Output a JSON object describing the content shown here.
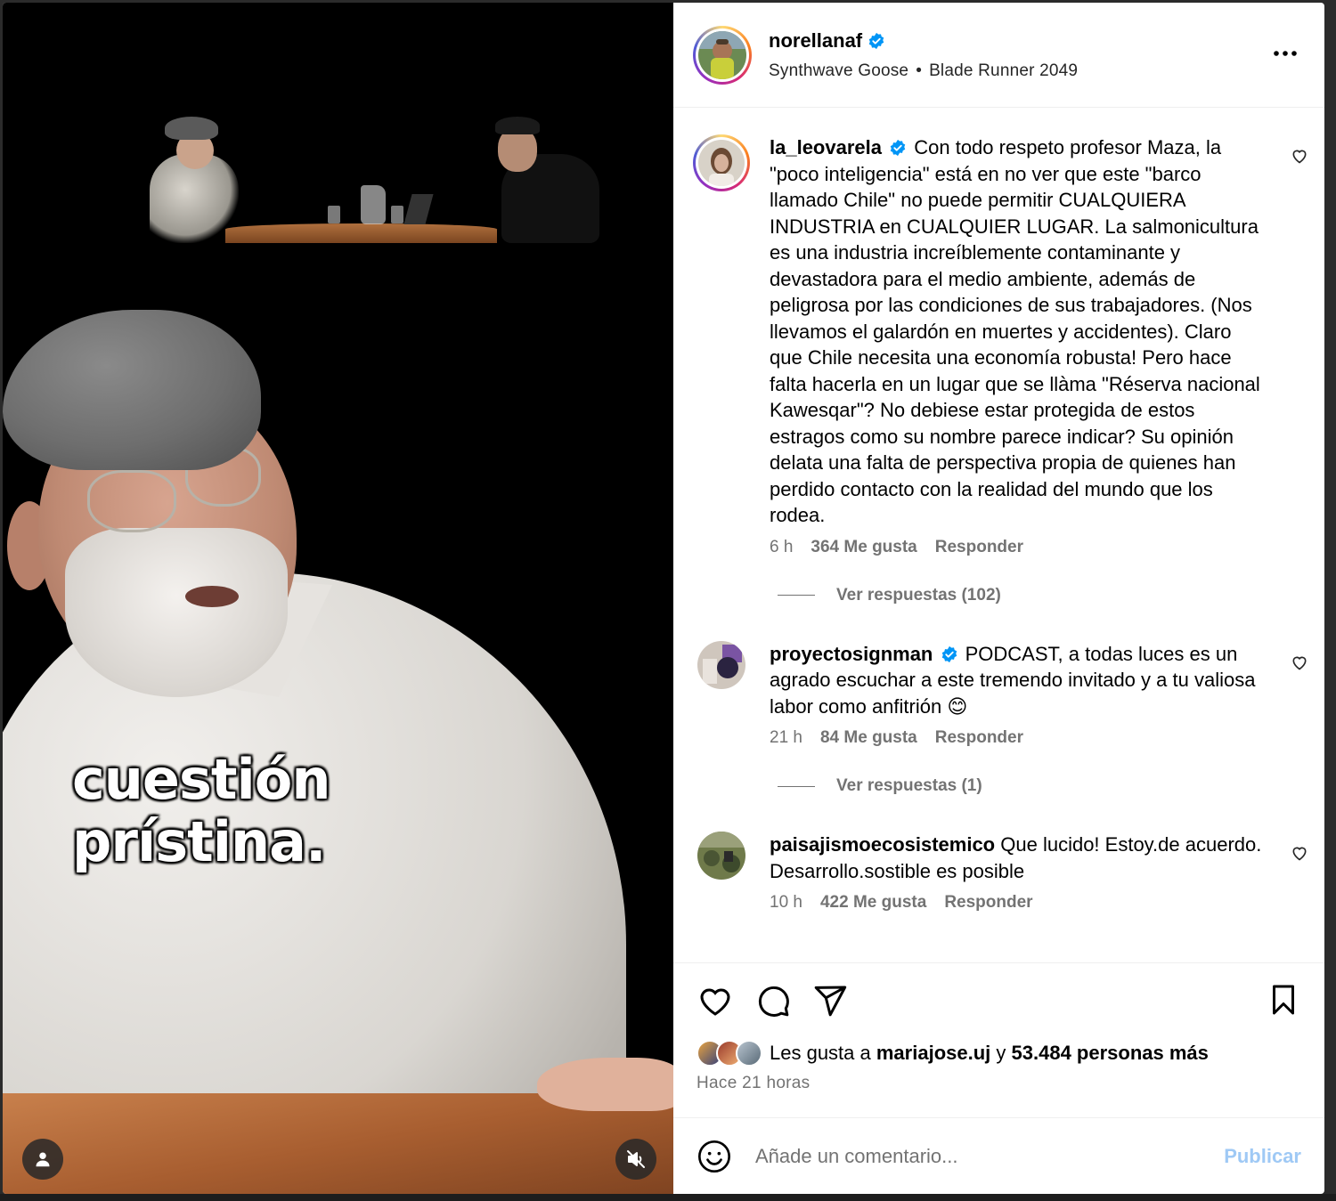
{
  "post": {
    "caption_line1": "cuestión",
    "caption_line2": "prístina."
  },
  "header": {
    "username": "norellanaf",
    "verified": true,
    "audio": "Synthwave Goose",
    "separator": "•",
    "location": "Blade Runner 2049",
    "more_icon": "more-horizontal-icon"
  },
  "comments": [
    {
      "username": "la_leovarela",
      "verified": true,
      "text": "Con todo respeto profesor Maza, la \"poco inteligencia\" está en no ver que este \"barco llamado Chile\" no puede permitir CUALQUIERA INDUSTRIA en CUALQUIER LUGAR. La salmonicultura es una industria increíblemente contaminante y devastadora para el medio ambiente, además de peligrosa por las condiciones de sus trabajadores. (Nos llevamos el galardón en muertes y accidentes). Claro que Chile necesita una economía robusta! Pero hace falta hacerla en un lugar que se llàma \"Réserva nacional Kawesqar\"? No debiese estar protegida de estos estragos como su nombre parece indicar? Su opinión delata una falta de perspectiva propia de quienes han perdido contacto con la realidad del mundo que los rodea.",
      "time": "6 h",
      "likes": "364 Me gusta",
      "reply": "Responder",
      "view_replies": "Ver respuestas (102)"
    },
    {
      "username": "proyectosignman",
      "verified": true,
      "text": "PODCAST, a todas luces es un agrado escuchar a este tremendo invitado y a tu valiosa labor como anfitrión 😊",
      "time": "21 h",
      "likes": "84 Me gusta",
      "reply": "Responder",
      "view_replies": "Ver respuestas (1)"
    },
    {
      "username": "paisajismoecosistemico",
      "verified": false,
      "text": "Que lucido! Estoy.de acuerdo. Desarrollo.sostible es posible",
      "time": "10 h",
      "likes": "422 Me gusta",
      "reply": "Responder",
      "view_replies": ""
    }
  ],
  "actions": {
    "likes_prefix": "Les gusta a",
    "liked_by": "mariajose.uj",
    "conjunction": "y",
    "others": "53.484 personas más",
    "time_ago": "Hace 21 horas"
  },
  "composer": {
    "placeholder": "Añade un comentario...",
    "publish": "Publicar"
  },
  "colors": {
    "verified": "#0095f6",
    "muted_text": "#737373",
    "publish_disabled": "#9fc9f5"
  }
}
